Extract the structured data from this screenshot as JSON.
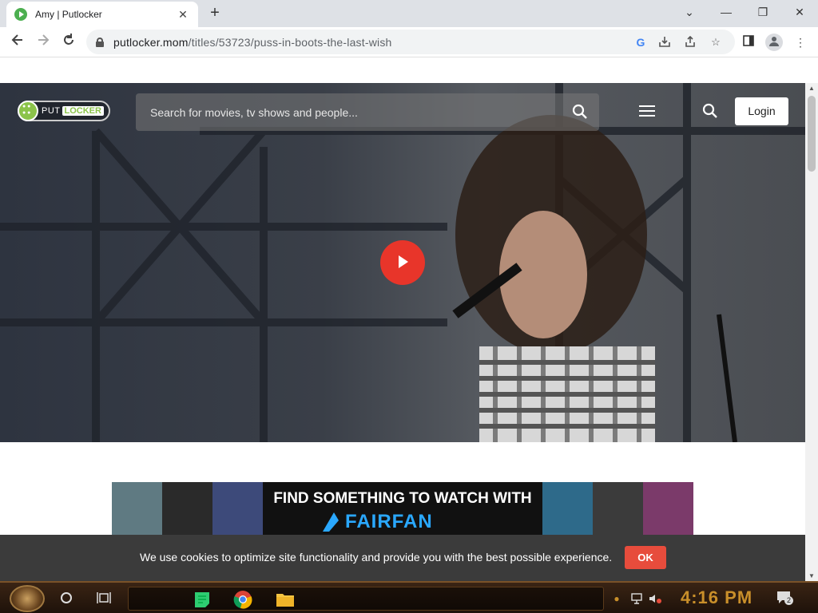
{
  "browser": {
    "tab_title": "Amy | Putlocker",
    "tab_close": "✕",
    "new_tab": "+",
    "url_host": "putlocker.mom",
    "url_path": "/titles/53723/puss-in-boots-the-last-wish",
    "window_controls": {
      "dropdown": "⌄",
      "minimize": "—",
      "restore": "❐",
      "close": "✕"
    }
  },
  "site": {
    "logo_put": "PUT",
    "logo_locker": "LOCKER",
    "search_placeholder": "Search for movies, tv shows and people...",
    "login_label": "Login"
  },
  "ad": {
    "headline": "FIND SOMETHING TO WATCH WITH",
    "brand": "FAIRFAN",
    "brand_color": "#2aa8ff"
  },
  "cookie": {
    "message": "We use cookies to optimize site functionality and provide you with the best possible experience.",
    "ok_label": "OK"
  },
  "taskbar": {
    "clock": "4:16 PM",
    "notification_count": "2"
  },
  "colors": {
    "play_button": "#e8352a",
    "accent_green": "#8bc34a",
    "cookie_ok": "#e74c3c"
  }
}
